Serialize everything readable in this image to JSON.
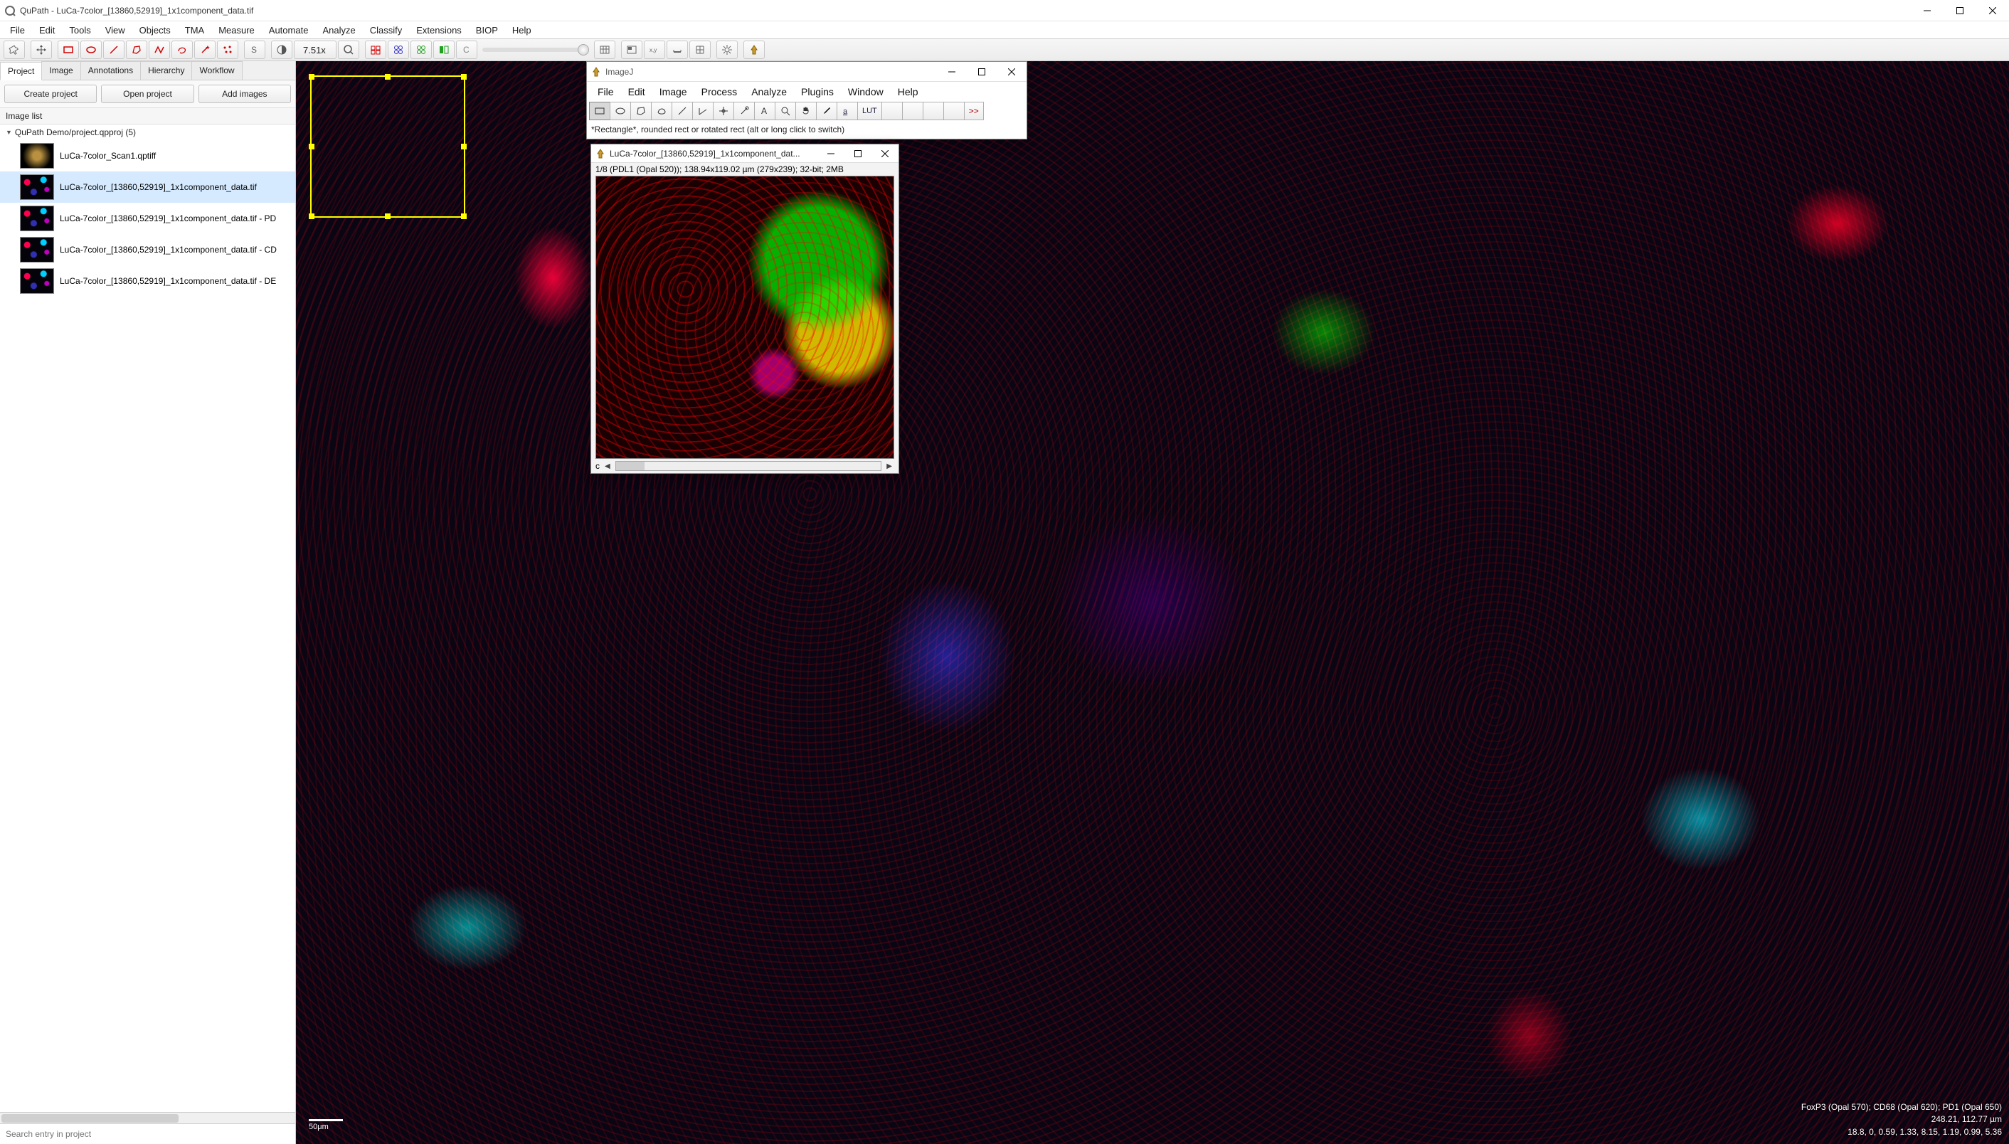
{
  "window": {
    "title": "QuPath - LuCa-7color_[13860,52919]_1x1component_data.tif"
  },
  "menu": {
    "items": [
      "File",
      "Edit",
      "Tools",
      "View",
      "Objects",
      "TMA",
      "Measure",
      "Automate",
      "Analyze",
      "Classify",
      "Extensions",
      "BIOP",
      "Help"
    ]
  },
  "toolbar": {
    "zoom_label": "7.51x"
  },
  "sidebar": {
    "tabs": [
      "Project",
      "Image",
      "Annotations",
      "Hierarchy",
      "Workflow"
    ],
    "active_tab_index": 0,
    "buttons": {
      "create": "Create project",
      "open": "Open project",
      "add": "Add images"
    },
    "section": "Image list",
    "project_root": "QuPath Demo/project.qpproj (5)",
    "images": [
      {
        "label": "LuCa-7color_Scan1.qptiff",
        "thumb": "t1",
        "selected": false
      },
      {
        "label": "LuCa-7color_[13860,52919]_1x1component_data.tif",
        "thumb": "t2",
        "selected": true
      },
      {
        "label": "LuCa-7color_[13860,52919]_1x1component_data.tif - PD",
        "thumb": "t2",
        "selected": false
      },
      {
        "label": "LuCa-7color_[13860,52919]_1x1component_data.tif - CD",
        "thumb": "t2",
        "selected": false
      },
      {
        "label": "LuCa-7color_[13860,52919]_1x1component_data.tif - DE",
        "thumb": "t2",
        "selected": false
      }
    ],
    "search_placeholder": "Search entry in project"
  },
  "viewport": {
    "scalebar": "50μm",
    "info_line1": "FoxP3 (Opal 570); CD68 (Opal 620); PD1 (Opal 650)",
    "info_line2": "248.21, 112.77 µm",
    "info_line3": "18.8, 0, 0.59, 1.33, 8.15, 1.19, 0.99, 5.36"
  },
  "imagej": {
    "title": "ImageJ",
    "menu": [
      "File",
      "Edit",
      "Image",
      "Process",
      "Analyze",
      "Plugins",
      "Window",
      "Help"
    ],
    "lut_label": "LUT",
    "more_glyph": ">>",
    "tooltip": "*Rectangle*, rounded rect or rotated rect (alt or long click to switch)",
    "img_window": {
      "title": "LuCa-7color_[13860,52919]_1x1component_dat...",
      "meta": "1/8 (PDL1 (Opal 520)); 138.94x119.02 µm (279x239); 32-bit; 2MB",
      "channel_label": "c"
    }
  }
}
